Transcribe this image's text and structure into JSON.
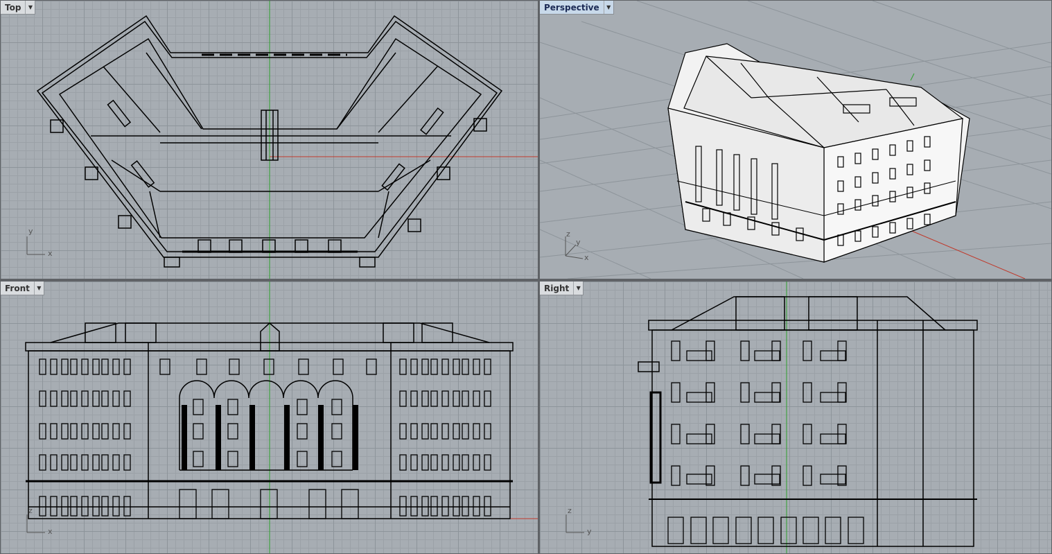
{
  "viewports": {
    "top": {
      "title": "Top",
      "axis_x": "x",
      "axis_y": "y"
    },
    "persp": {
      "title": "Perspective",
      "axis_x": "x",
      "axis_y": "y",
      "axis_z": "z"
    },
    "front": {
      "title": "Front",
      "axis_x": "x",
      "axis_z": "z"
    },
    "right": {
      "title": "Right",
      "axis_y": "y",
      "axis_z": "z"
    }
  },
  "menu_icon": "chevron-down-icon",
  "colors": {
    "viewport_bg": "#a7adb3",
    "grid": "#8d949a",
    "x_axis": "#c0392b",
    "y_axis": "#2ca02c",
    "wire": "#000000",
    "active_tab": "#c8d9ea"
  }
}
